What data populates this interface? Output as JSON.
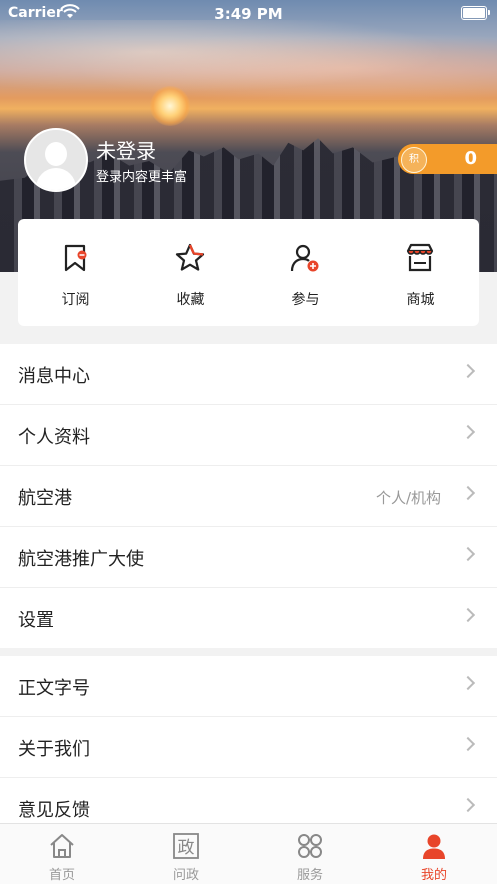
{
  "status_bar": {
    "carrier": "Carrier",
    "time": "3:49 PM"
  },
  "profile": {
    "name": "未登录",
    "subtitle": "登录内容更丰富",
    "points_badge": "积",
    "points": "0"
  },
  "quick_actions": [
    {
      "label": "订阅",
      "icon": "bookmark-icon"
    },
    {
      "label": "收藏",
      "icon": "star-icon"
    },
    {
      "label": "参与",
      "icon": "user-add-icon"
    },
    {
      "label": "商城",
      "icon": "shop-icon"
    }
  ],
  "menu_group_1": [
    {
      "label": "消息中心"
    },
    {
      "label": "个人资料"
    },
    {
      "label": "航空港",
      "extra": "个人/机构"
    },
    {
      "label": "航空港推广大使"
    },
    {
      "label": "设置"
    }
  ],
  "menu_group_2": [
    {
      "label": "正文字号"
    },
    {
      "label": "关于我们"
    },
    {
      "label": "意见反馈"
    }
  ],
  "tabbar": {
    "items": [
      {
        "label": "首页",
        "icon": "home-icon"
      },
      {
        "label": "问政",
        "icon": "politics-icon",
        "glyph": "政"
      },
      {
        "label": "服务",
        "icon": "grid-icon"
      },
      {
        "label": "我的",
        "icon": "person-icon"
      }
    ],
    "active_index": 3
  },
  "colors": {
    "accent": "#e8452a",
    "points_bg": "#f39b2a"
  }
}
